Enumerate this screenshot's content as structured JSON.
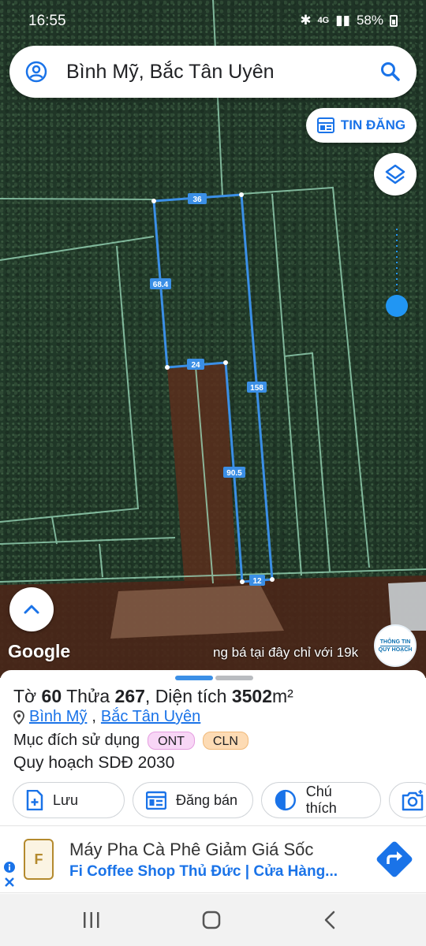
{
  "status": {
    "time": "16:55",
    "network": "4G",
    "battery": "58%"
  },
  "search": {
    "query": "Bình Mỹ, Bắc Tân Uyên"
  },
  "map": {
    "tin_dang_label": "TIN ĐĂNG",
    "segments": [
      "36",
      "68.4",
      "24",
      "158",
      "90.5",
      "12"
    ],
    "google_label": "Google",
    "ad_text": "ng bá tại đây chỉ với 19k",
    "badge_line1": "THÔNG TIN",
    "badge_line2": "QUY HOẠCH"
  },
  "parcel": {
    "to_label": "Tờ",
    "to_value": "60",
    "thua_label": "Thửa",
    "thua_value": "267",
    "area_label": "Diện tích",
    "area_value": "3502",
    "area_unit": "m²",
    "commune": "Bình Mỹ",
    "district": "Bắc Tân Uyên",
    "purpose_label": "Mục đích sử dụng",
    "tags": [
      {
        "label": "ONT",
        "bg": "#f8d6f6",
        "border": "#e59ee0"
      },
      {
        "label": "CLN",
        "bg": "#fddbb4",
        "border": "#f0b97a"
      }
    ],
    "plan_label": "Quy hoạch SDĐ 2030"
  },
  "actions": {
    "save": "Lưu",
    "sell": "Đăng bán",
    "legend": "Chú thích"
  },
  "ad_banner": {
    "headline": "Máy Pha Cà Phê Giảm Giá Sốc",
    "subline": "Fi Coffee Shop Thủ Đức | Cửa Hàng..."
  },
  "colors": {
    "parcel_outline": "#3b8fe6",
    "grid_lines": "#9fe0c0",
    "accent": "#1a73e8",
    "handle_active": "#3b8fe6",
    "handle_inactive": "#b9bcc0"
  }
}
